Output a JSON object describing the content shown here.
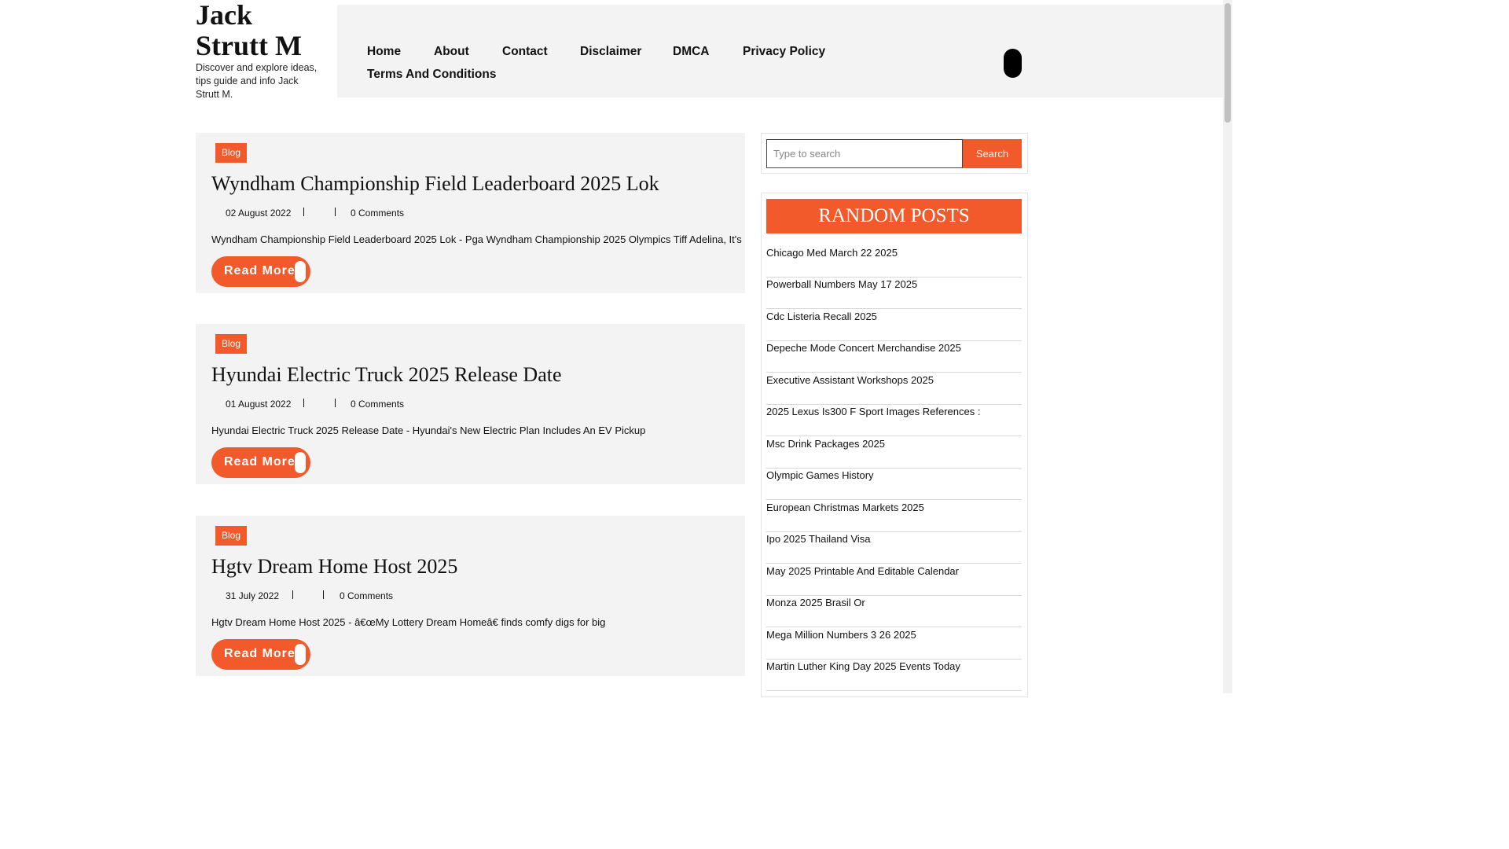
{
  "site": {
    "title": "Jack Strutt M",
    "description": "Discover and explore ideas, tips guide and info Jack Strutt M."
  },
  "nav": {
    "items": [
      "Home",
      "About",
      "Contact",
      "Disclaimer",
      "DMCA",
      "Privacy Policy",
      "Terms And Conditions"
    ]
  },
  "posts": [
    {
      "category": "Blog",
      "title": "Wyndham Championship Field Leaderboard 2025 Lok",
      "date": "02 August 2022",
      "comments": "0 Comments",
      "excerpt": "Wyndham Championship Field Leaderboard 2025 Lok - Pga Wyndham Championship 2025 Olympics Tiff Adelina, It's",
      "read_more": "Read More"
    },
    {
      "category": "Blog",
      "title": "Hyundai Electric Truck 2025 Release Date",
      "date": "01 August 2022",
      "comments": "0 Comments",
      "excerpt": "Hyundai Electric Truck 2025 Release Date - Hyundai's New Electric Plan Includes An EV Pickup",
      "read_more": "Read More"
    },
    {
      "category": "Blog",
      "title": "Hgtv Dream Home Host 2025",
      "date": "31 July 2022",
      "comments": "0 Comments",
      "excerpt": "Hgtv Dream Home Host 2025 - â€œMy Lottery Dream Homeâ€ finds comfy digs for big",
      "read_more": "Read More"
    }
  ],
  "search": {
    "placeholder": "Type to search",
    "button": "Search"
  },
  "random_posts": {
    "title": "RANDOM POSTS",
    "items": [
      "Chicago Med March 22 2025",
      "Powerball Numbers May 17 2025",
      "Cdc Listeria Recall 2025",
      "Depeche Mode Concert Merchandise 2025",
      "Executive Assistant Workshops 2025",
      "2025 Lexus Is300 F Sport Images References :",
      "Msc Drink Packages 2025",
      "Olympic Games History",
      "European Christmas Markets 2025",
      "Ipo 2025 Thailand Visa",
      "May 2025 Printable And Editable Calendar",
      "Monza 2025 Brasil Or",
      "Mega Million Numbers 3 26 2025",
      "Martin Luther King Day 2025 Events Today"
    ]
  },
  "colors": {
    "accent": "#f25a2b",
    "panel": "#f3f3f3"
  }
}
